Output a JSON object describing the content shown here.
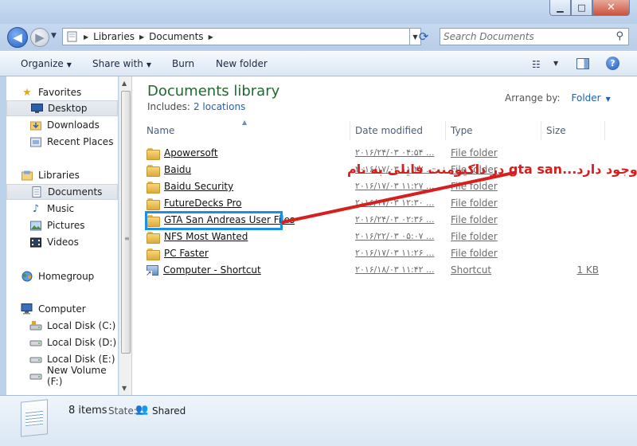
{
  "window": {
    "controls": {
      "minimize": "▁",
      "maximize": "□",
      "close": "✕"
    }
  },
  "nav": {
    "back": "◀",
    "forward": "▶",
    "breadcrumb": [
      "Libraries",
      "Documents"
    ],
    "search_placeholder": "Search Documents"
  },
  "toolbar": {
    "organize": "Organize",
    "share_with": "Share with",
    "burn": "Burn",
    "new_folder": "New folder"
  },
  "sidebar": {
    "items": [
      {
        "label": "Favorites",
        "icon": "star-icon",
        "kind": "group"
      },
      {
        "label": "Desktop",
        "icon": "desktop-icon",
        "kind": "item",
        "selected": true
      },
      {
        "label": "Downloads",
        "icon": "downloads-icon",
        "kind": "item"
      },
      {
        "label": "Recent Places",
        "icon": "recent-places-icon",
        "kind": "item"
      },
      {
        "label": "Libraries",
        "icon": "libraries-icon",
        "kind": "group"
      },
      {
        "label": "Documents",
        "icon": "documents-icon",
        "kind": "item",
        "selected": true
      },
      {
        "label": "Music",
        "icon": "music-icon",
        "kind": "item"
      },
      {
        "label": "Pictures",
        "icon": "pictures-icon",
        "kind": "item"
      },
      {
        "label": "Videos",
        "icon": "videos-icon",
        "kind": "item"
      },
      {
        "label": "Homegroup",
        "icon": "homegroup-icon",
        "kind": "group"
      },
      {
        "label": "Computer",
        "icon": "computer-icon",
        "kind": "group"
      },
      {
        "label": "Local Disk (C:)",
        "icon": "drive-icon",
        "kind": "item"
      },
      {
        "label": "Local Disk (D:)",
        "icon": "drive-icon",
        "kind": "item"
      },
      {
        "label": "Local Disk (E:)",
        "icon": "drive-icon",
        "kind": "item"
      },
      {
        "label": "New Volume (F:)",
        "icon": "drive-icon",
        "kind": "item"
      }
    ]
  },
  "library": {
    "title": "Documents library",
    "includes_label": "Includes:",
    "includes_link": "2 locations",
    "arrange_label": "Arrange by:",
    "arrange_value": "Folder"
  },
  "columns": {
    "name": "Name",
    "date": "Date modified",
    "type": "Type",
    "size": "Size"
  },
  "files": [
    {
      "name": "Apowersoft",
      "date": "۲۰۱۶/۲۴/۰۳ ۰۴:۵۴ ...",
      "type": "File folder",
      "size": "",
      "icon": "folder-icon"
    },
    {
      "name": "Baidu",
      "date": "۲۰۱۶/۱۷/۰۳ ۱۱:۲۷ ...",
      "type": "File folder",
      "size": "",
      "icon": "folder-icon"
    },
    {
      "name": "Baidu Security",
      "date": "۲۰۱۶/۱۷/۰۳ ۱۱:۲۷ ...",
      "type": "File folder",
      "size": "",
      "icon": "folder-icon"
    },
    {
      "name": "FutureDecks Pro",
      "date": "۲۰۱۶/۱۷/۰۳ ۱۲:۳۰ ...",
      "type": "File folder",
      "size": "",
      "icon": "folder-icon"
    },
    {
      "name": "GTA San Andreas User Files",
      "date": "۲۰۱۶/۲۴/۰۳ ۰۲:۳۶ ...",
      "type": "File folder",
      "size": "",
      "icon": "folder-icon"
    },
    {
      "name": "NFS Most Wanted",
      "date": "۲۰۱۶/۲۲/۰۳ ۰۵:۰۷ ...",
      "type": "File folder",
      "size": "",
      "icon": "folder-icon"
    },
    {
      "name": "PC Faster",
      "date": "۲۰۱۶/۱۷/۰۳ ۱۱:۲۶ ...",
      "type": "File folder",
      "size": "",
      "icon": "folder-icon"
    },
    {
      "name": "Computer - Shortcut",
      "date": "۲۰۱۶/۱۸/۰۳ ۱۱:۴۲ ...",
      "type": "Shortcut",
      "size": "1 KB",
      "icon": "shortcut-icon"
    }
  ],
  "annotation": {
    "text": "وجود دارد...gta san در داکیومنت فایلی به نام",
    "color": "#d61f1f",
    "highlight_color": "#1e8fe0"
  },
  "details": {
    "count": "8 items",
    "state_label": "State:",
    "state_value": "Shared"
  }
}
